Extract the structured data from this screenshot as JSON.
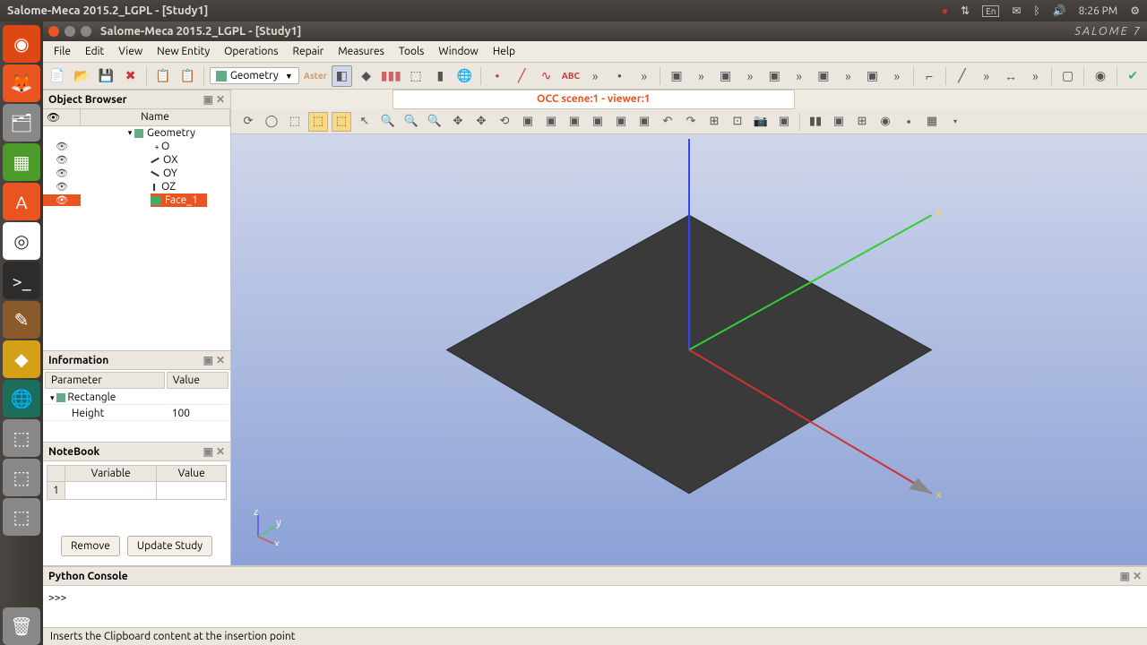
{
  "system": {
    "title": "Salome-Meca 2015.2_LGPL - [Study1]",
    "time": "8:26 PM",
    "lang": "En"
  },
  "window": {
    "title": "Salome-Meca 2015.2_LGPL - [Study1]",
    "brand": "SALOME 7"
  },
  "menu": [
    "File",
    "Edit",
    "View",
    "New Entity",
    "Operations",
    "Repair",
    "Measures",
    "Tools",
    "Window",
    "Help"
  ],
  "module": {
    "label": "Geometry"
  },
  "aster_label": "Aster",
  "object_browser": {
    "title": "Object Browser",
    "col_name": "Name",
    "tree": {
      "root": "Geometry",
      "children": [
        {
          "name": "O"
        },
        {
          "name": "OX"
        },
        {
          "name": "OY"
        },
        {
          "name": "OZ"
        },
        {
          "name": "Face_1",
          "selected": true
        }
      ]
    }
  },
  "information": {
    "title": "Information",
    "cols": {
      "param": "Parameter",
      "value": "Value"
    },
    "rows": [
      {
        "param": "Rectangle",
        "value": "",
        "expandable": true
      },
      {
        "param": "Height",
        "value": "100"
      }
    ]
  },
  "notebook": {
    "title": "NoteBook",
    "cols": {
      "variable": "Variable",
      "value": "Value"
    },
    "rows": [
      {
        "idx": "1",
        "variable": "",
        "value": ""
      }
    ],
    "remove": "Remove",
    "update": "Update Study"
  },
  "viewer": {
    "tab": "OCC scene:1 - viewer:1",
    "triad": {
      "x": "x",
      "y": "y",
      "z": "z"
    },
    "axis_labels": {
      "x": "x",
      "y": "y"
    }
  },
  "python_console": {
    "title": "Python Console",
    "prompt": ">>>"
  },
  "status": "Inserts the Clipboard content at the insertion point"
}
